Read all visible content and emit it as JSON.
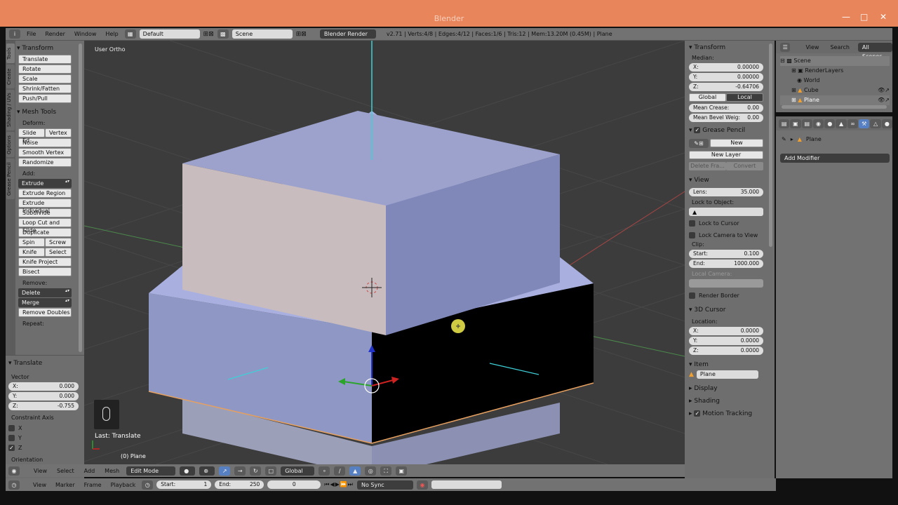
{
  "window": {
    "title": "Blender"
  },
  "topbar": {
    "menus": [
      "File",
      "Render",
      "Window",
      "Help"
    ],
    "screen_layout": "Default",
    "scene": "Scene",
    "render_engine": "Blender Render",
    "info": "v2.71 | Verts:4/8 | Edges:4/12 | Faces:1/6 | Tris:12 | Mem:13.20M (0.45M) | Plane"
  },
  "tool_tabs": [
    "Tools",
    "Create",
    "Shading / UVs",
    "Options",
    "Grease Pencil"
  ],
  "toolshelf": {
    "transform_header": "Transform",
    "transform_buttons": [
      "Translate",
      "Rotate",
      "Scale",
      "Shrink/Fatten",
      "Push/Pull"
    ],
    "mesh_tools_header": "Mesh Tools",
    "deform_label": "Deform:",
    "slide_edge": "Slide Ed",
    "vertex": "Vertex",
    "noise": "Noise",
    "smooth_vertex": "Smooth Vertex",
    "randomize": "Randomize",
    "add_label": "Add:",
    "extrude": "Extrude",
    "extrude_region": "Extrude Region",
    "extrude_individual": "Extrude Individual",
    "subdivide": "Subdivide",
    "loop_cut": "Loop Cut and Slide",
    "duplicate": "Duplicate",
    "spin": "Spin",
    "screw": "Screw",
    "knife": "Knife",
    "select": "Select",
    "knife_project": "Knife Project",
    "bisect": "Bisect",
    "remove_label": "Remove:",
    "delete": "Delete",
    "merge": "Merge",
    "remove_doubles": "Remove Doubles",
    "repeat_label": "Repeat:"
  },
  "operator_panel": {
    "header": "Translate",
    "vector_label": "Vector",
    "x_label": "X:",
    "x_value": "0.000",
    "y_label": "Y:",
    "y_value": "0.000",
    "z_label": "Z:",
    "z_value": "-0.755",
    "constraint_label": "Constraint Axis",
    "axis_x": "X",
    "axis_y": "Y",
    "axis_z": "Z",
    "orientation_label": "Orientation"
  },
  "viewport": {
    "view_label": "User Ortho",
    "last_op": "Last: Translate",
    "object_label": "(0) Plane"
  },
  "viewport_header": {
    "menus": [
      "View",
      "Select",
      "Add",
      "Mesh"
    ],
    "mode": "Edit Mode",
    "orientation": "Global"
  },
  "properties_n": {
    "transform_header": "Transform",
    "median_label": "Median:",
    "x_label": "X:",
    "x_value": "0.00000",
    "y_label": "Y:",
    "y_value": "0.00000",
    "z_label": "Z:",
    "z_value": "-0.64706",
    "global_btn": "Global",
    "local_btn": "Local",
    "mean_crease_label": "Mean Crease:",
    "mean_crease_value": "0.00",
    "mean_bevel_label": "Mean Bevel Weig:",
    "mean_bevel_value": "0.00",
    "grease_header": "Grease Pencil",
    "new_btn": "New",
    "new_layer_btn": "New Layer",
    "delete_frame_btn": "Delete Fra...",
    "convert_btn": "Convert",
    "view_header": "View",
    "lens_label": "Lens:",
    "lens_value": "35.000",
    "lock_object_label": "Lock to Object:",
    "lock_cursor": "Lock to Cursor",
    "lock_camera": "Lock Camera to View",
    "clip_label": "Clip:",
    "start_label": "Start:",
    "start_value": "0.100",
    "end_label": "End:",
    "end_value": "1000.000",
    "local_camera_label": "Local Camera:",
    "render_border": "Render Border",
    "cursor_header": "3D Cursor",
    "location_label": "Location:",
    "cx_label": "X:",
    "cx_value": "0.0000",
    "cy_label": "Y:",
    "cy_value": "0.0000",
    "cz_label": "Z:",
    "cz_value": "0.0000",
    "item_header": "Item",
    "item_name": "Plane",
    "display_header": "Display",
    "shading_header": "Shading",
    "motion_header": "Motion Tracking"
  },
  "outliner": {
    "view_menu": "View",
    "search_menu": "Search",
    "filter": "All Scenes",
    "items": [
      "Scene",
      "RenderLayers",
      "World",
      "Cube",
      "Plane"
    ]
  },
  "modifiers": {
    "object_name": "Plane",
    "add_modifier": "Add Modifier"
  },
  "timeline": {
    "menus": [
      "View",
      "Marker",
      "Frame",
      "Playback"
    ],
    "start_label": "Start:",
    "start_value": "1",
    "end_label": "End:",
    "end_value": "250",
    "current_frame": "0",
    "sync": "No Sync"
  },
  "colors": {
    "titlebar": "#e9855b",
    "panel": "#6e6e6e",
    "viewport_bg": "#3c3c3c",
    "mesh_face": "#8f97c4",
    "selected_face": "#000000",
    "highlight": "#5680c2"
  }
}
